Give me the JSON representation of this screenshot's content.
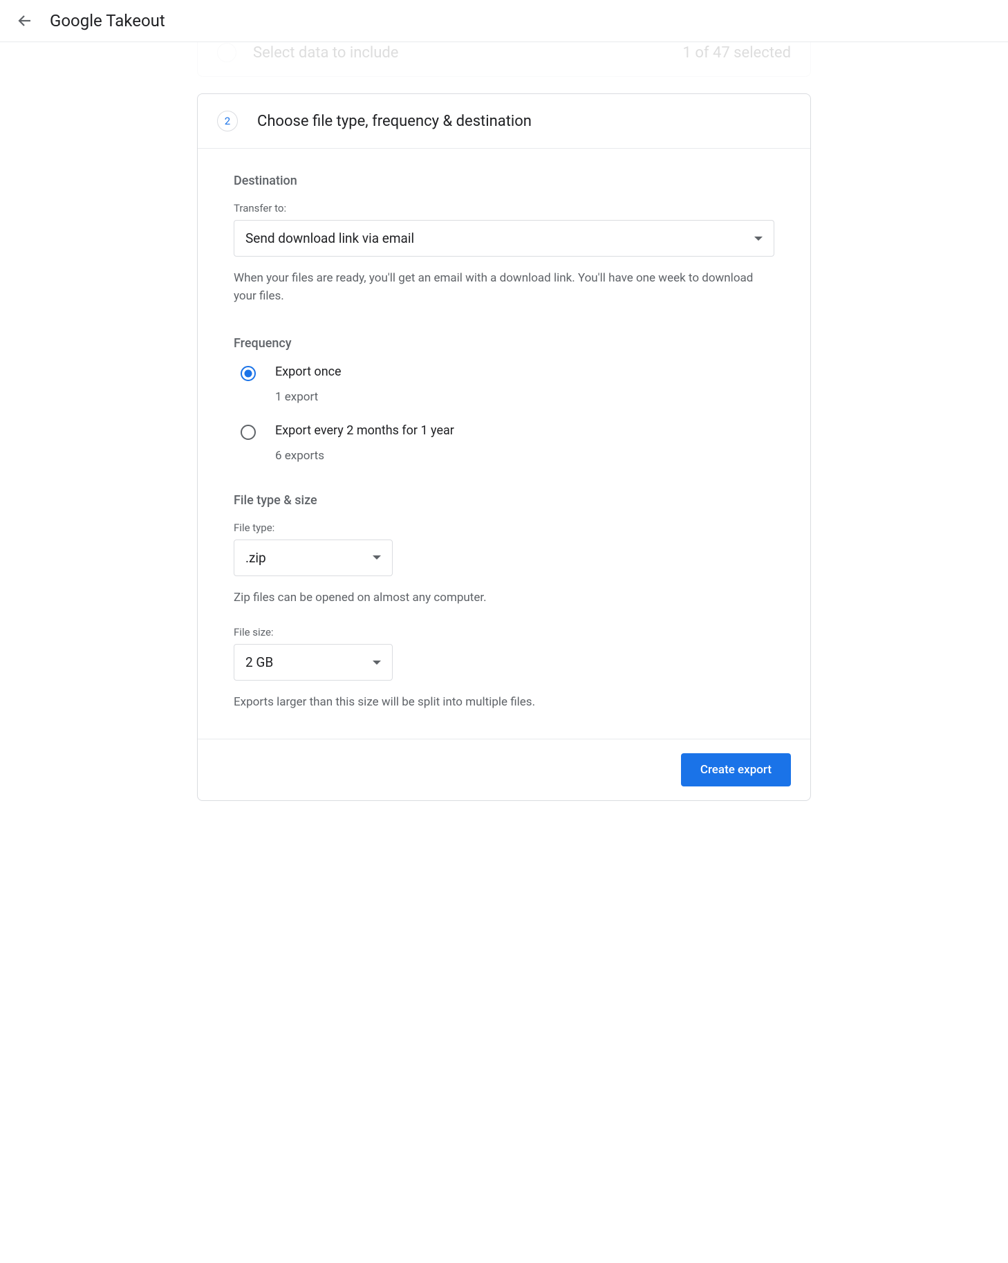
{
  "header": {
    "title": "Google Takeout"
  },
  "step1_ghost": {
    "title": "Select data to include",
    "status": "1 of 47 selected"
  },
  "step2": {
    "number": "2",
    "title": "Choose file type, frequency & destination"
  },
  "destination": {
    "heading": "Destination",
    "transfer_label": "Transfer to:",
    "transfer_value": "Send download link via email",
    "help": "When your files are ready, you'll get an email with a download link. You'll have one week to download your files."
  },
  "frequency": {
    "heading": "Frequency",
    "options": [
      {
        "label": "Export once",
        "sublabel": "1 export",
        "selected": true
      },
      {
        "label": "Export every 2 months for 1 year",
        "sublabel": "6 exports",
        "selected": false
      }
    ]
  },
  "filetype": {
    "heading": "File type & size",
    "type_label": "File type:",
    "type_value": ".zip",
    "type_help": "Zip files can be opened on almost any computer.",
    "size_label": "File size:",
    "size_value": "2 GB",
    "size_help": "Exports larger than this size will be split into multiple files."
  },
  "footer": {
    "create_button": "Create export"
  }
}
